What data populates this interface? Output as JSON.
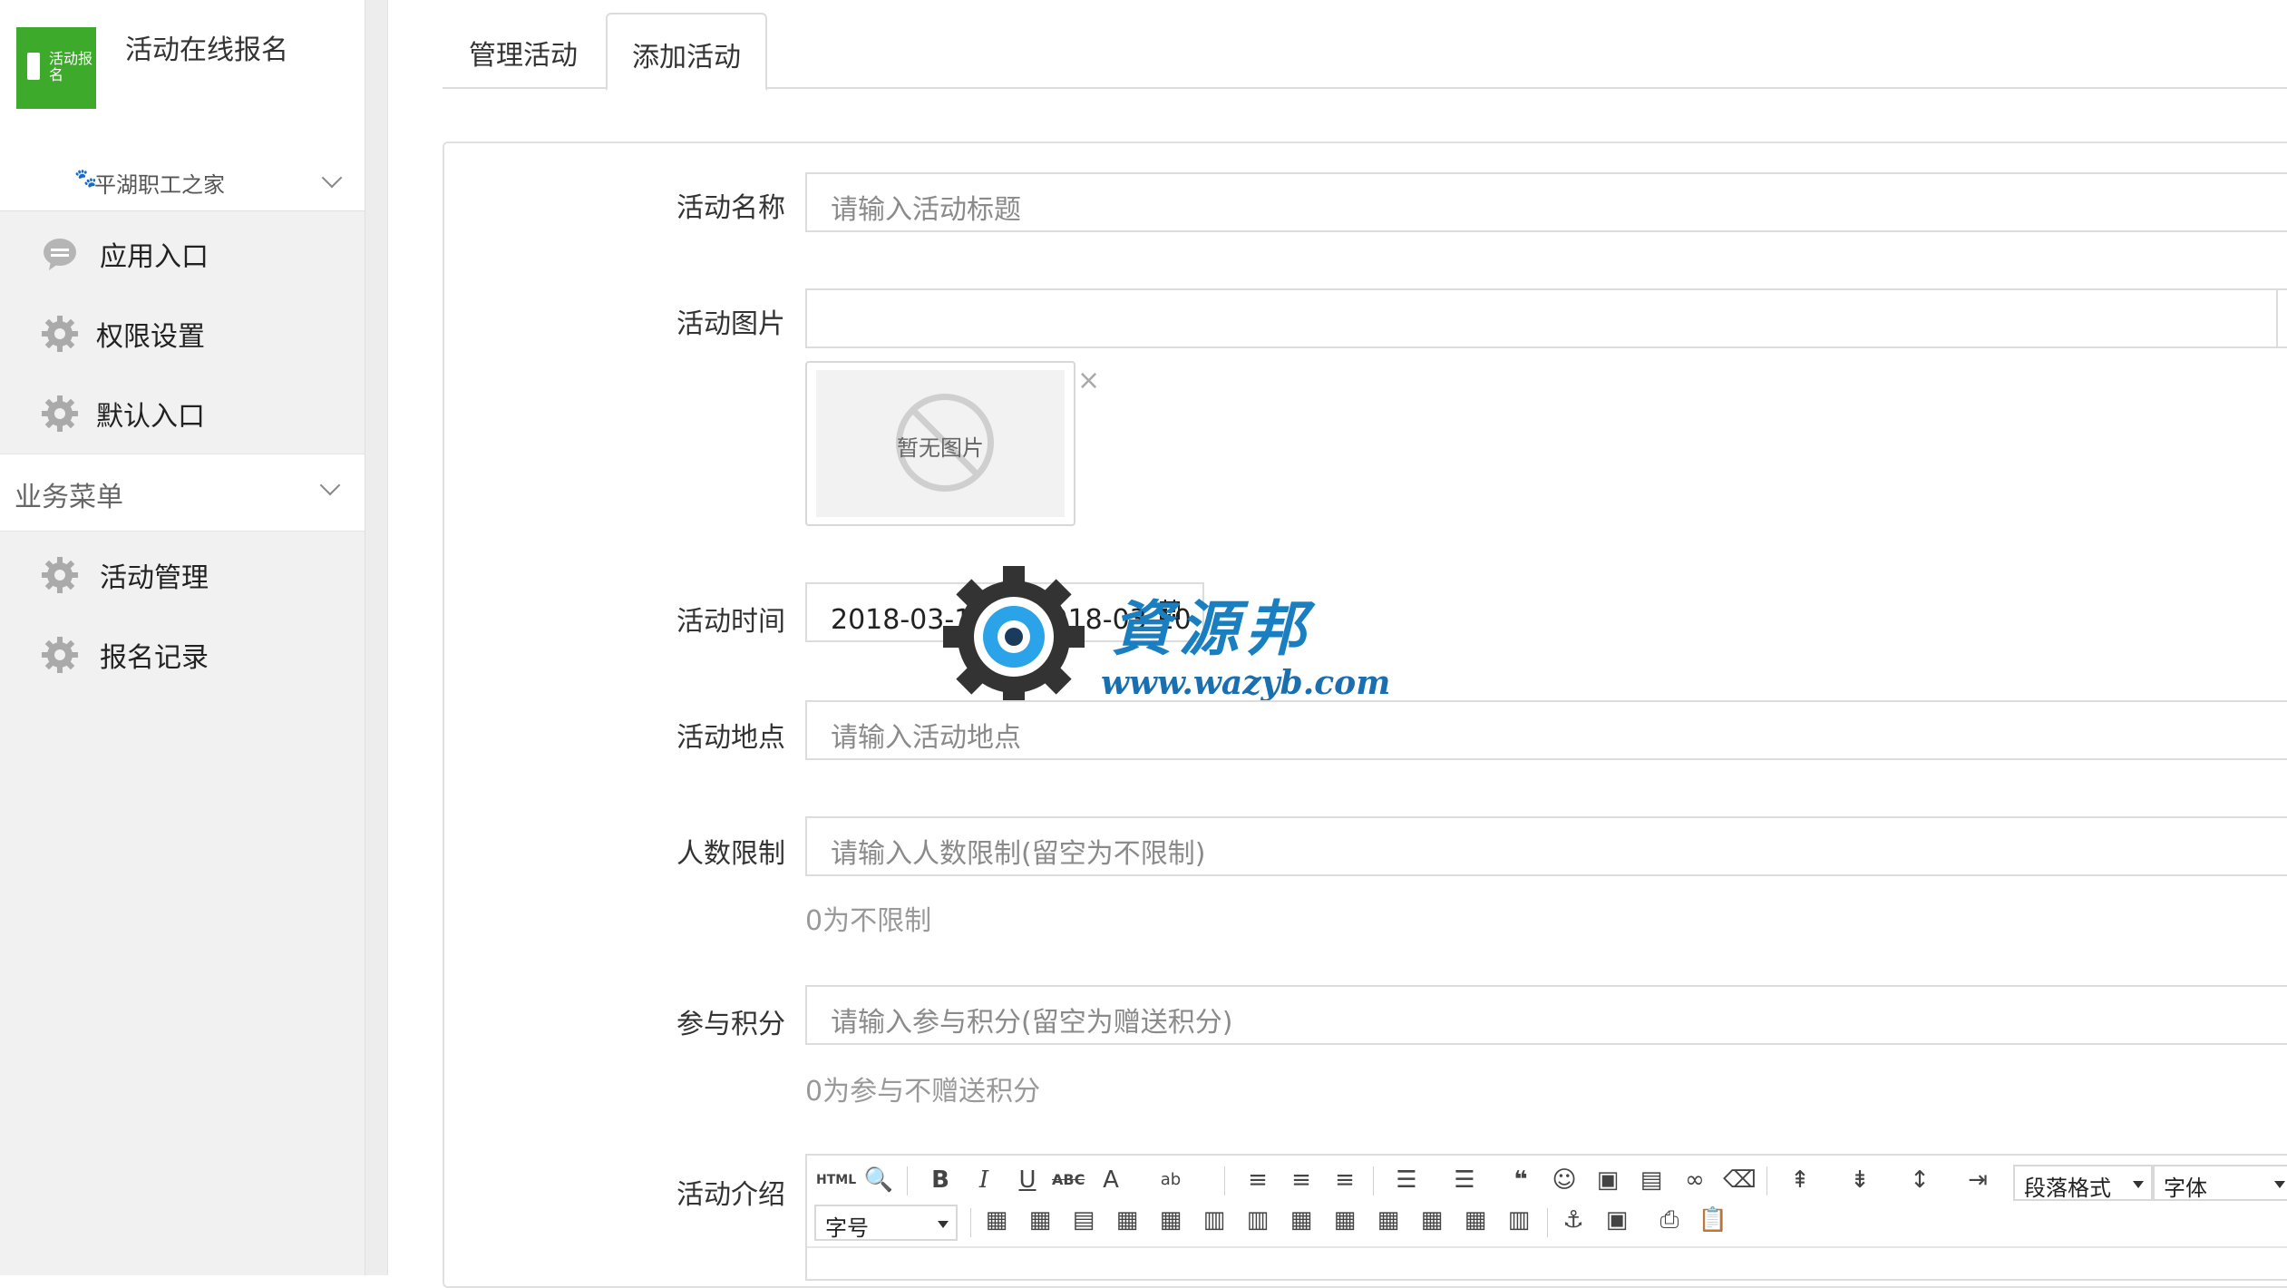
{
  "sidebar": {
    "logo_text": "活动报名",
    "app_name": "活动在线报名",
    "org_name": "平湖职工之家",
    "items": [
      {
        "label": "应用入口",
        "icon": "chat-bubble-icon"
      },
      {
        "label": "权限设置",
        "icon": "gear-icon"
      },
      {
        "label": "默认入口",
        "icon": "gear-icon"
      }
    ],
    "section": {
      "label": "业务菜单",
      "items": [
        {
          "label": "活动管理",
          "icon": "gear-icon"
        },
        {
          "label": "报名记录",
          "icon": "gear-icon"
        }
      ]
    }
  },
  "tabs": [
    {
      "label": "管理活动",
      "active": false
    },
    {
      "label": "添加活动",
      "active": true
    }
  ],
  "form": {
    "title": {
      "label": "活动名称",
      "placeholder": "请输入活动标题"
    },
    "image": {
      "label": "活动图片",
      "value": "",
      "no_image_text": "暂无图片",
      "remove_symbol": "×"
    },
    "time": {
      "label": "活动时间",
      "value": "2018-03-10 至 2018-03-10"
    },
    "location": {
      "label": "活动地点",
      "placeholder": "请输入活动地点"
    },
    "limit": {
      "label": "人数限制",
      "placeholder": "请输入人数限制(留空为不限制)",
      "help": "0为不限制"
    },
    "points": {
      "label": "参与积分",
      "placeholder": "请输入参与积分(留空为赠送积分)",
      "help": "0为参与不赠送积分"
    },
    "intro": {
      "label": "活动介绍",
      "toolbar": {
        "html_label": "HTML",
        "bold": "B",
        "italic": "I",
        "underline": "U",
        "strike": "ABC",
        "font_color": "A",
        "paragraph_select": "段落格式",
        "font_select": "字体",
        "size_select": "字号"
      }
    }
  },
  "watermark": {
    "text": "資源邦",
    "url": "www.wazyb.com"
  },
  "colors": {
    "brand_green": "#3daa2b",
    "watermark_blue": "#1a7fc1"
  }
}
